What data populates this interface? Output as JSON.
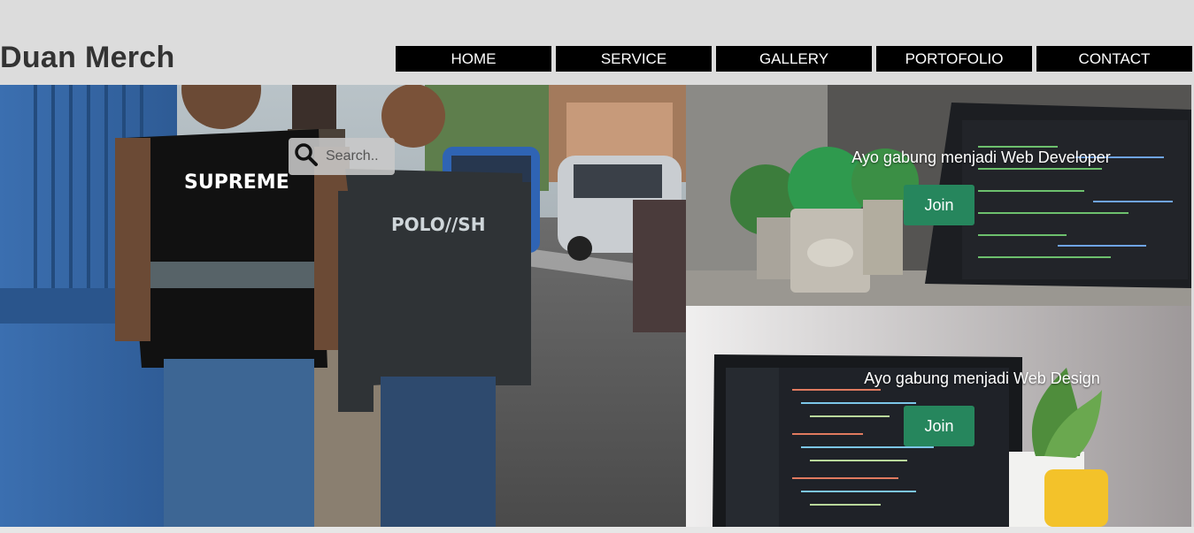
{
  "brand": {
    "title": "Duan Merch"
  },
  "nav": {
    "items": [
      {
        "label": "HOME"
      },
      {
        "label": "SERVICE"
      },
      {
        "label": "GALLERY"
      },
      {
        "label": "PORTOFOLIO"
      },
      {
        "label": "CONTACT"
      }
    ]
  },
  "hero": {
    "search": {
      "placeholder": "Search.."
    },
    "shirt_front": "SUPREME",
    "shirt_right": "POLO//SH"
  },
  "cards": [
    {
      "caption": "Ayo gabung menjadi Web Developer",
      "button": "Join"
    },
    {
      "caption": "Ayo gabung menjadi Web Design",
      "button": "Join"
    }
  ],
  "colors": {
    "nav_bg": "#000000",
    "nav_text": "#ffffff",
    "join_button": "#26865d",
    "page_bg": "#dcdcdc"
  }
}
